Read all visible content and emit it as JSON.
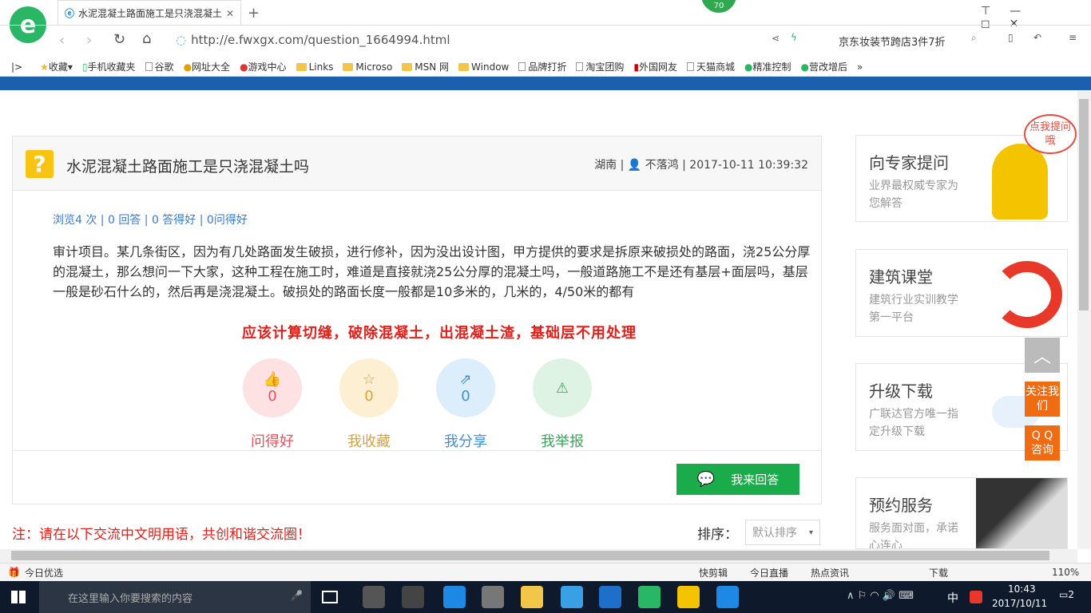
{
  "browser": {
    "tab_title": "水泥混凝土路面施工是只浇混凝土",
    "url": "http://e.fwxgx.com/question_1664994.html",
    "badge": "70",
    "search_hint": "京东妆装节跨店3件7折"
  },
  "bookmarks": [
    "收藏",
    "手机收藏夹",
    "谷歌",
    "网址大全",
    "游戏中心",
    "Links",
    "Microso",
    "MSN 网",
    "Window",
    "品牌打折",
    "淘宝团购",
    "外国网友",
    "天猫商城",
    "精准控制",
    "营改增后"
  ],
  "question": {
    "icon": "?",
    "title": "水泥混凝土路面施工是只浇混凝土吗",
    "meta": "湖南 | 👤 不落鸿 | 2017-10-11 10:39:32",
    "stats": "浏览4 次 | 0 回答 | 0 答得好 | 0问得好",
    "body": "审计项目。某几条街区，因为有几处路面发生破损，进行修补，因为没出设计图，甲方提供的要求是拆原来破损处的路面，浇25公分厚的混凝土，那么想问一下大家，这种工程在施工时，难道是直接就浇25公分厚的混凝土吗，一般道路施工不是还有基层+面层吗，基层一般是砂石什么的，然后再是浇混凝土。破损处的路面长度一般都是10多米的，几米的，4/50米的都有",
    "red_note": "应该计算切缝，破除混凝土，出混凝土渣，基础层不用处理",
    "actions": [
      {
        "label": "问得好",
        "count": "0",
        "icon": "👍",
        "color": "#e8505b",
        "bg": "#fde1e3"
      },
      {
        "label": "我收藏",
        "count": "0",
        "icon": "☆",
        "color": "#d8a23a",
        "bg": "#fdf0d2"
      },
      {
        "label": "我分享",
        "count": "0",
        "icon": "⇗",
        "color": "#3b8fd6",
        "bg": "#dcedfb"
      },
      {
        "label": "我举报",
        "count": "",
        "icon": "⚠",
        "color": "#3aa55a",
        "bg": "#dff3e4"
      }
    ],
    "answer_button": "我来回答"
  },
  "footer": {
    "notice": "注：请在以下交流中文明用语，共创和谐交流圈！",
    "sort_label": "排序：",
    "sort_value": "默认排序"
  },
  "sidebar": [
    {
      "title": "向专家提问",
      "sub": "业界最权威专家为您解答"
    },
    {
      "title": "建筑课堂",
      "sub": "建筑行业实训教学第一平台"
    },
    {
      "title": "升级下载",
      "sub": "广联达官方唯一指定升级下载"
    },
    {
      "title": "预约服务",
      "sub": "服务面对面，承诺心连心"
    }
  ],
  "float": {
    "bubble": "点我提问哦",
    "follow": "关注我们",
    "qq": "Q Q 咨询"
  },
  "statusbar": {
    "left": "今日优选",
    "items": [
      "快剪辑",
      "今日直播",
      "热点资讯",
      "下载"
    ],
    "zoom": "110%"
  },
  "taskbar": {
    "search_placeholder": "在这里输入你要搜索的内容",
    "time": "10:43",
    "date": "2017/10/11",
    "ime": "中",
    "notif": "2"
  }
}
